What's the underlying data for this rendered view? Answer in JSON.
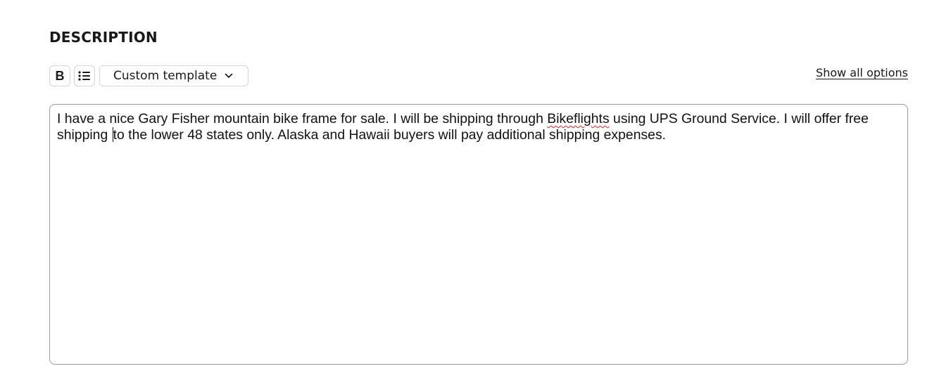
{
  "section": {
    "title": "DESCRIPTION"
  },
  "toolbar": {
    "bold_label": "B",
    "bold_icon": "bold-icon",
    "list_icon": "bulleted-list-icon",
    "template_label": "Custom template",
    "template_icon": "chevron-down-icon",
    "show_all_label": "Show all options"
  },
  "editor": {
    "text_before_word": "I have a nice Gary Fisher mountain bike frame for sale. I will be shipping through ",
    "misspelled_word": "Bikeflights",
    "text_before_caret": " using UPS Ground Service. I will offer free shipping ",
    "text_after_caret": "to the lower 48 states only. Alaska and Hawaii buyers will pay additional shipping expenses."
  }
}
